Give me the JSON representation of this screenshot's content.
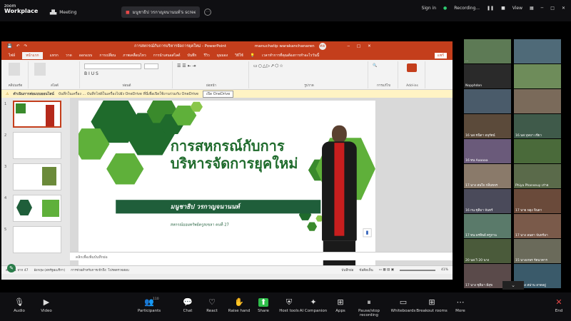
{
  "zoom": {
    "logo_top": "zoom",
    "logo_bottom": "Workplace",
    "tabs": [
      {
        "label": "Meeting"
      },
      {
        "label": "มนูชาธิป วรกาญจนานนท์'s screen"
      }
    ],
    "right": {
      "signin": "Sign in",
      "recording": "Recording...",
      "view": "View"
    }
  },
  "powerpoint": {
    "title": "การสหกรณ์กับการบริหารจัดการยุคใหม่ - PowerPoint",
    "user": "manuchatip warakanchanaren",
    "ribbon_tabs": [
      "ไฟล์",
      "หน้าแรก",
      "แทรก",
      "วาด",
      "ออกแบบ",
      "การเปลี่ยน",
      "ภาพเคลื่อนไหว",
      "การนำเสนอสไลด์",
      "บันทึก",
      "รีวิว",
      "มุมมอง",
      "วิธีใช้",
      "เวลาทำการที่คุณต้องการทำอะไรวันนี้"
    ],
    "active_tab": "หน้าแรก",
    "share_btn": "แชร์",
    "ribbon_groups": [
      "คลิปบอร์ด",
      "สไลด์",
      "ฟอนต์",
      "ย่อหน้า",
      "รูปวาด",
      "การแก้ไข",
      "Add-ins"
    ],
    "addins": "Add-ins",
    "notice": {
      "label": "ดำเนินการต่อแบบออนไลน์",
      "text": "บันทึกในเครื่อง ... บันทึกไฟล์ในเครื่องไปยัง OneDrive ที่นี่เพื่อเปิดใช้งานร่วมกับ OneDrive",
      "button": "เปิด OneDrive"
    },
    "slide_numbers": [
      "1",
      "2",
      "3",
      "4",
      "5"
    ],
    "slide": {
      "title_line1": "การสหกรณ์กับการ",
      "title_line2": "บริหารจัดการยุคใหม่",
      "speaker": "มนูชาธิป วรกาญจนานนท์",
      "org": "สหกรณ์ออมทรัพย์ครูสงขลา  คนที่ 27"
    },
    "notes_placeholder": "คลิกเพื่อเพิ่มบันทึกย่อ",
    "status": {
      "slide_info": "สไลด์ 1 จาก 47",
      "lang": "อังกฤษ (สหรัฐอเมริกา)",
      "access": "การช่วยสำหรับการเข้าถึง: โปรดตรวจสอบ",
      "notes": "บันทึกย่อ",
      "comments": "ข้อคิดเห็น",
      "zoom": "41%"
    }
  },
  "gallery": [
    {
      "name": "..."
    },
    {
      "name": ""
    },
    {
      "name": "Nopphdon"
    },
    {
      "name": ""
    },
    {
      "name": ""
    },
    {
      "name": ""
    },
    {
      "name": "16 นส.ชนิดา อนุรัตน์"
    },
    {
      "name": "16.นส.บุษบา เขียว"
    },
    {
      "name": "16 ทน Aaaaaa"
    },
    {
      "name": ""
    },
    {
      "name": "17.นาง สนใจ กลิ่นขจร"
    },
    {
      "name": "Phiya Phanseuy เก่าอ"
    },
    {
      "name": "16 กน.ชุติมา จันทร์"
    },
    {
      "name": "17 นาย พยุง จินดา"
    },
    {
      "name": "17 ทน.พรทิพย์ ครูถาน"
    },
    {
      "name": "17 นาง ลนดา จันทร์มา"
    },
    {
      "name": "20 นส.วิ 20 นาง"
    },
    {
      "name": "15 นางเกษร รัตนาคาร"
    },
    {
      "name": "17 นาง ชุติมา มีสุข"
    },
    {
      "name": "17 นาง สน่าน อาดอยู่"
    }
  ],
  "toolbar": [
    {
      "label": "Audio",
      "icon": "mic-icon"
    },
    {
      "label": "Video",
      "icon": "video-icon"
    },
    {
      "label": "Participants",
      "icon": "participants-icon",
      "count": "110"
    },
    {
      "label": "Chat",
      "icon": "chat-icon"
    },
    {
      "label": "React",
      "icon": "heart-icon"
    },
    {
      "label": "Raise hand",
      "icon": "hand-icon"
    },
    {
      "label": "Share",
      "icon": "share-icon"
    },
    {
      "label": "Host tools",
      "icon": "shield-icon"
    },
    {
      "label": "AI Companion",
      "icon": "sparkle-icon"
    },
    {
      "label": "Apps",
      "icon": "apps-icon"
    },
    {
      "label": "Pause/stop recording",
      "icon": "pause-icon"
    },
    {
      "label": "Whiteboards",
      "icon": "whiteboard-icon"
    },
    {
      "label": "Breakout rooms",
      "icon": "grid-icon"
    },
    {
      "label": "More",
      "icon": "more-icon"
    },
    {
      "label": "End",
      "icon": "end-icon"
    }
  ],
  "colors": {
    "ppt_red": "#c43e1c",
    "slide_green": "#3a8a2c",
    "zoom_bg": "#0f0f12"
  }
}
